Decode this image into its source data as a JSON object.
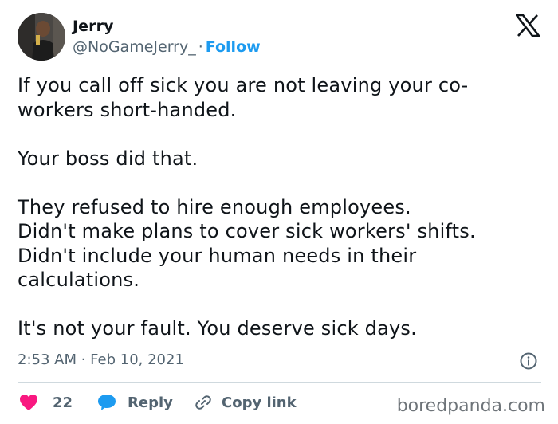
{
  "user": {
    "name": "Jerry",
    "handle": "@NoGameJerry_",
    "separator": "·",
    "follow_label": "Follow"
  },
  "tweet": {
    "text": "If you call off sick you are not leaving your co-\nworkers short-handed.\n\nYour boss did that.\n\nThey refused to hire enough employees.\nDidn't make plans to cover sick workers' shifts.\nDidn't include your human needs in their\ncalculations.\n\nIt's not your fault. You deserve sick days.",
    "timestamp": "2:53 AM · Feb 10, 2021"
  },
  "actions": {
    "like_count": "22",
    "reply_label": "Reply",
    "copy_link_label": "Copy link"
  },
  "watermark": "boredpanda.com",
  "colors": {
    "accent": "#1d9bf0",
    "like": "#f91880",
    "text": "#0f1419",
    "secondary": "#536471"
  }
}
